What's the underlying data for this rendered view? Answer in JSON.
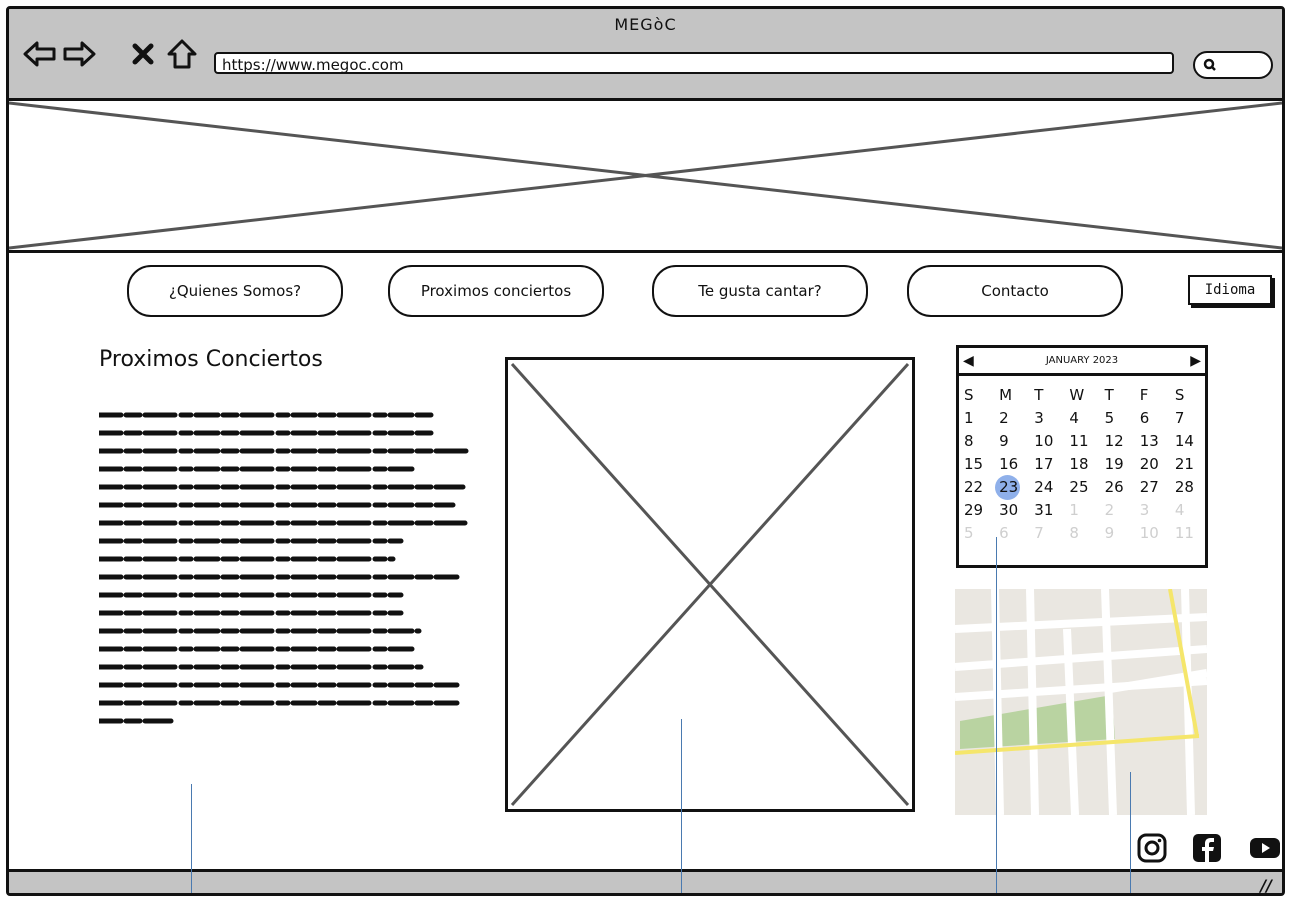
{
  "window": {
    "title": "MEGòC"
  },
  "browser": {
    "url": "https://www.megoc.com",
    "icons": [
      "back-arrow-icon",
      "forward-arrow-icon",
      "close-x-icon",
      "home-icon",
      "search-icon"
    ]
  },
  "nav": {
    "items": [
      {
        "label": "¿Quienes Somos?"
      },
      {
        "label": "Proximos conciertos"
      },
      {
        "label": "Te gusta cantar?"
      },
      {
        "label": "Contacto"
      }
    ],
    "language_button": "Idioma"
  },
  "main": {
    "title": "Proximos Conciertos"
  },
  "calendar": {
    "month_label": "JANUARY 2023",
    "weekdays": [
      "S",
      "M",
      "T",
      "W",
      "T",
      "F",
      "S"
    ],
    "selected_day": 23,
    "days": [
      "1",
      "2",
      "3",
      "4",
      "5",
      "6",
      "7",
      "8",
      "9",
      "10",
      "11",
      "12",
      "13",
      "14",
      "15",
      "16",
      "17",
      "18",
      "19",
      "20",
      "21",
      "22",
      "23",
      "24",
      "25",
      "26",
      "27",
      "28",
      "29",
      "30",
      "31",
      "1",
      "2",
      "3",
      "4",
      "5",
      "6",
      "7",
      "8",
      "9",
      "10",
      "11"
    ],
    "outside_month_indexes": [
      31,
      32,
      33,
      34,
      35,
      36,
      37,
      38,
      39,
      40,
      41
    ]
  },
  "social": {
    "icons": [
      "instagram-icon",
      "facebook-icon",
      "youtube-icon"
    ]
  },
  "colors": {
    "chrome": "#c4c4c4",
    "selected_day": "#8fb0ea",
    "map_park": "#b9d3a1",
    "map_road_major": "#f5e66b",
    "connector": "#4a7ab0"
  }
}
